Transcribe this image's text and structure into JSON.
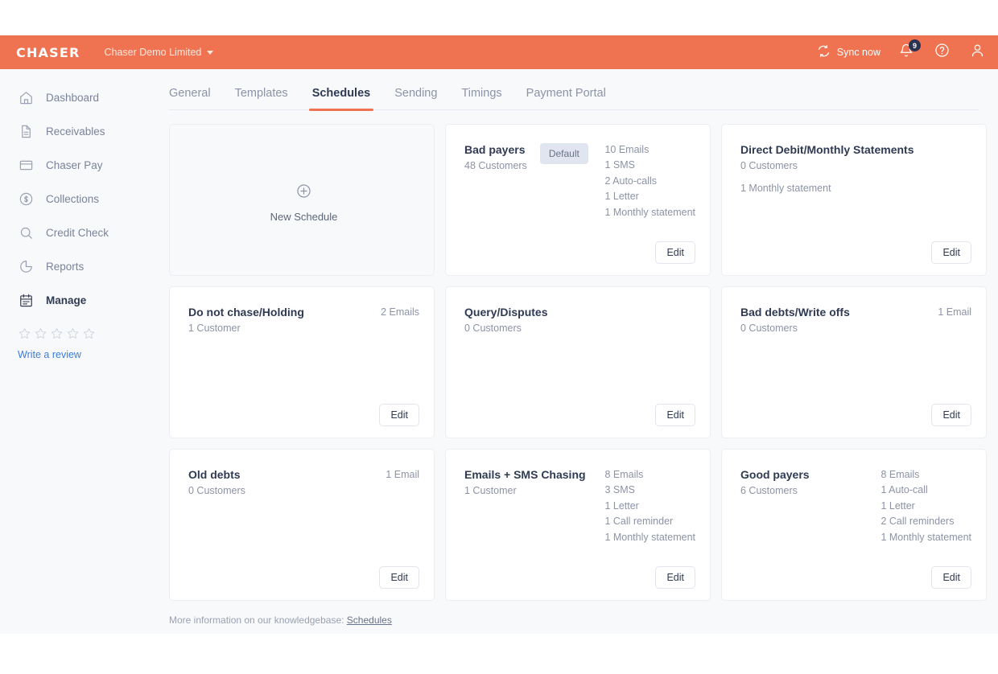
{
  "topbar": {
    "brand": "CHASER",
    "org": "Chaser Demo Limited",
    "sync_label": "Sync now",
    "notification_count": "9",
    "accent_color": "#ef7350",
    "badge_color": "#2a3250"
  },
  "sidebar": {
    "items": [
      {
        "label": "Dashboard",
        "icon": "home-icon",
        "active": false
      },
      {
        "label": "Receivables",
        "icon": "document-icon",
        "active": false
      },
      {
        "label": "Chaser Pay",
        "icon": "card-icon",
        "active": false
      },
      {
        "label": "Collections",
        "icon": "dollar-circle-icon",
        "active": false
      },
      {
        "label": "Credit Check",
        "icon": "search-icon",
        "active": false
      },
      {
        "label": "Reports",
        "icon": "pie-chart-icon",
        "active": false
      },
      {
        "label": "Manage",
        "icon": "calendar-icon",
        "active": true
      }
    ],
    "review": {
      "stars": 5,
      "filled": 0,
      "link_label": "Write a review",
      "link_color": "#3b7ddd"
    }
  },
  "tabs": [
    {
      "label": "General",
      "active": false
    },
    {
      "label": "Templates",
      "active": false
    },
    {
      "label": "Schedules",
      "active": true
    },
    {
      "label": "Sending",
      "active": false
    },
    {
      "label": "Timings",
      "active": false
    },
    {
      "label": "Payment Portal",
      "active": false
    }
  ],
  "new_schedule": {
    "label": "New Schedule",
    "icon": "plus-circle-icon"
  },
  "edit_label": "Edit",
  "default_badge_label": "Default",
  "cards": [
    {
      "title": "Bad payers",
      "customers": "48 Customers",
      "is_default": true,
      "actions": [
        "10 Emails",
        "1 SMS",
        "2 Auto-calls",
        "1 Letter",
        "1 Monthly statement"
      ],
      "actions_right_aligned": false,
      "extra": ""
    },
    {
      "title": "Direct Debit/Monthly Statements",
      "customers": "0 Customers",
      "is_default": false,
      "actions": [],
      "actions_right_aligned": false,
      "extra": "1 Monthly statement"
    },
    {
      "title": "Do not chase/Holding",
      "customers": "1 Customer",
      "is_default": false,
      "actions": [
        "2 Emails"
      ],
      "actions_right_aligned": true,
      "extra": ""
    },
    {
      "title": "Query/Disputes",
      "customers": "0 Customers",
      "is_default": false,
      "actions": [],
      "actions_right_aligned": true,
      "extra": ""
    },
    {
      "title": "Bad debts/Write offs",
      "customers": "0 Customers",
      "is_default": false,
      "actions": [
        "1 Email"
      ],
      "actions_right_aligned": true,
      "extra": ""
    },
    {
      "title": "Old debts",
      "customers": "0 Customers",
      "is_default": false,
      "actions": [
        "1 Email"
      ],
      "actions_right_aligned": true,
      "extra": ""
    },
    {
      "title": "Emails + SMS Chasing",
      "customers": "1 Customer",
      "is_default": false,
      "actions": [
        "8 Emails",
        "3 SMS",
        "1 Letter",
        "1 Call reminder",
        "1 Monthly statement"
      ],
      "actions_right_aligned": false,
      "extra": ""
    },
    {
      "title": "Good payers",
      "customers": "6 Customers",
      "is_default": false,
      "actions": [
        "8 Emails",
        "1 Auto-call",
        "1 Letter",
        "2 Call reminders",
        "1 Monthly statement"
      ],
      "actions_right_aligned": false,
      "extra": ""
    }
  ],
  "footer": {
    "text": "More information on our knowledgebase: ",
    "link": "Schedules"
  }
}
